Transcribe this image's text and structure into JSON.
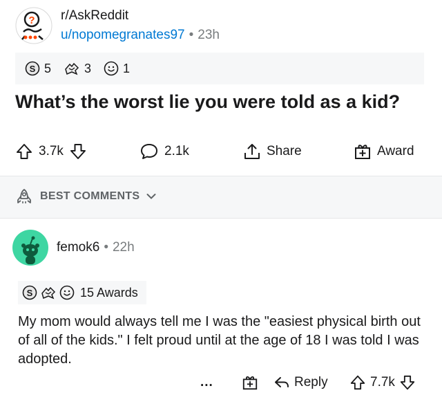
{
  "post": {
    "subreddit": "r/AskReddit",
    "username": "u/nopomegranates97",
    "time": "23h",
    "awards": [
      {
        "icon": "silver-award-icon",
        "count": "5"
      },
      {
        "icon": "helpful-award-icon",
        "count": "3"
      },
      {
        "icon": "wholesome-award-icon",
        "count": "1"
      }
    ],
    "title": "What’s the worst lie you were told as a kid?",
    "upvotes": "3.7k",
    "comments": "2.1k",
    "share_label": "Share",
    "award_label": "Award"
  },
  "sort": {
    "label": "BEST COMMENTS"
  },
  "comment": {
    "username": "femok6",
    "time": "22h",
    "awards_label": "15 Awards",
    "body": "My mom would always tell me I was the \"easiest physical birth out of all of the kids.\" I felt proud until at the age of 18 I was told I was adopted.",
    "more": "...",
    "reply_label": "Reply",
    "votes": "7.7k"
  },
  "separator_dot": "•"
}
